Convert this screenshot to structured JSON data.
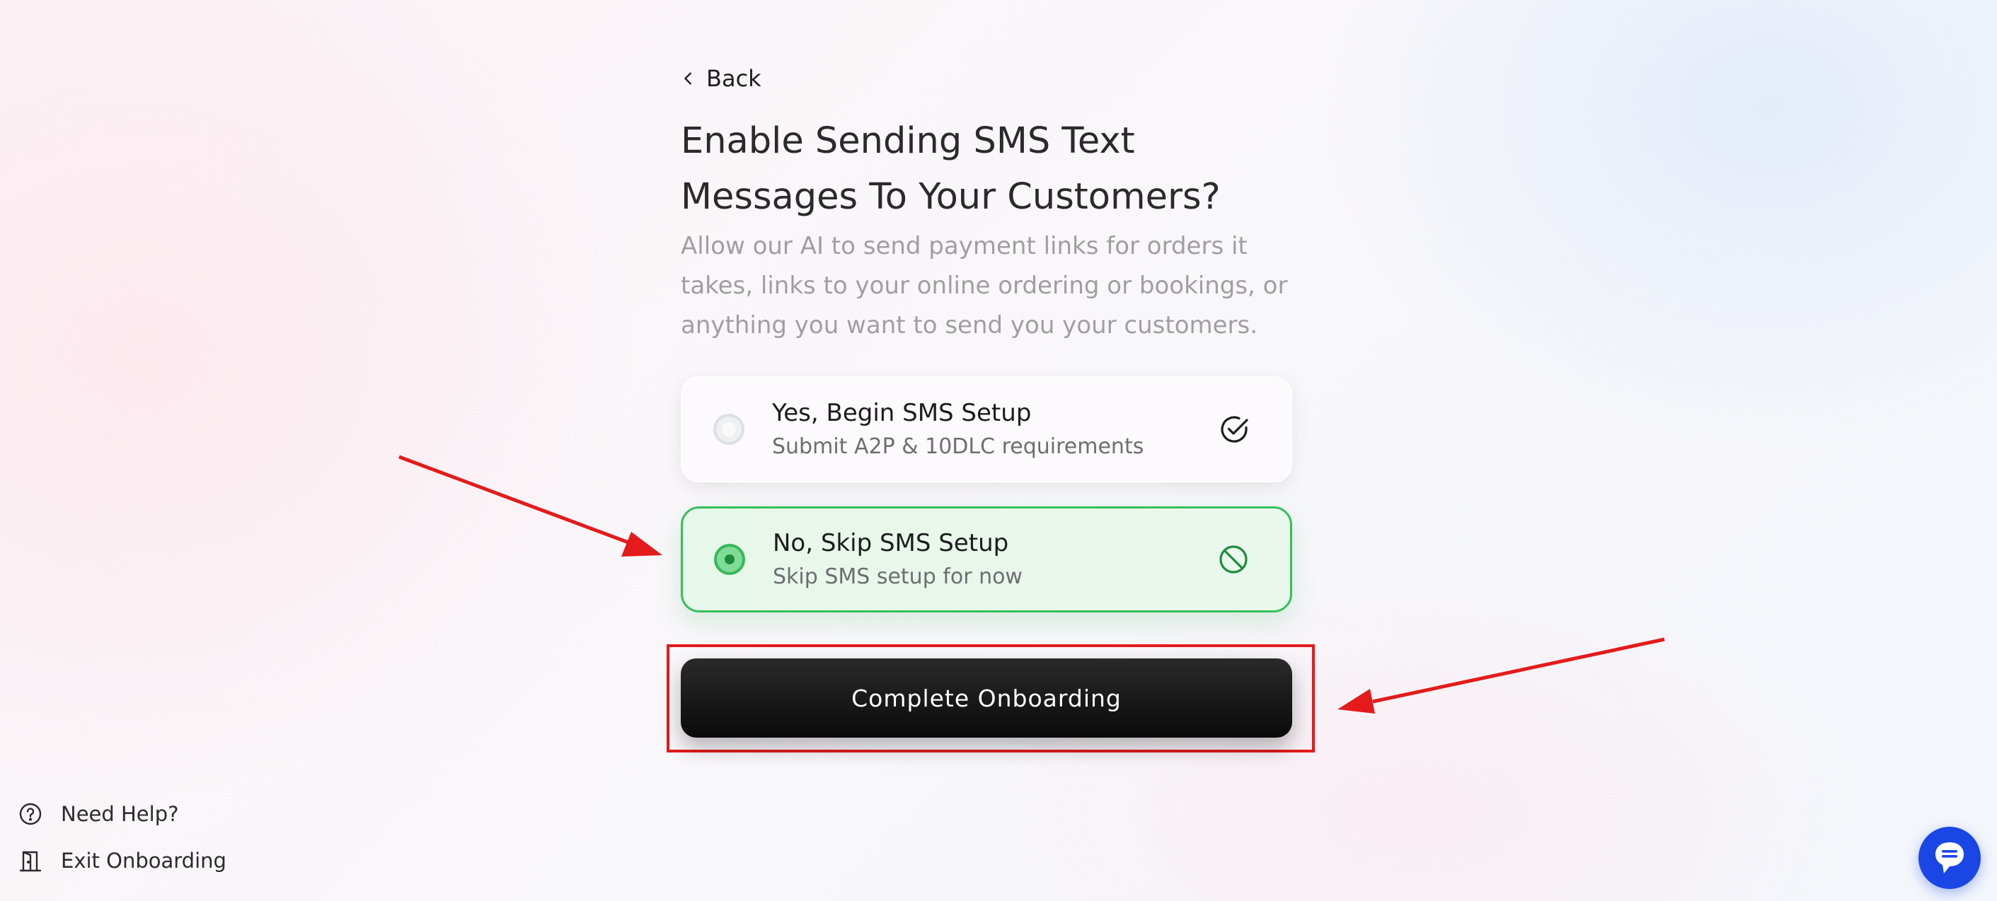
{
  "nav": {
    "back_label": "Back"
  },
  "header": {
    "title": "Enable Sending SMS Text Messages To Your Customers?",
    "subtitle": "Allow our AI to send payment links for orders it takes, links to your online ordering or bookings, or anything you want to send you your customers."
  },
  "options": [
    {
      "title": "Yes, Begin SMS Setup",
      "description": "Submit A2P & 10DLC requirements",
      "icon": "check-circle-icon",
      "selected": false
    },
    {
      "title": "No, Skip SMS Setup",
      "description": "Skip SMS setup for now",
      "icon": "ban-icon",
      "selected": true
    }
  ],
  "actions": {
    "complete_label": "Complete Onboarding"
  },
  "footer": {
    "help_label": "Need Help?",
    "exit_label": "Exit Onboarding"
  },
  "colors": {
    "accent_selected": "#33c05a",
    "primary_button": "#111111",
    "annotation": "#e31b1b",
    "chat_button": "#1a46e6"
  }
}
